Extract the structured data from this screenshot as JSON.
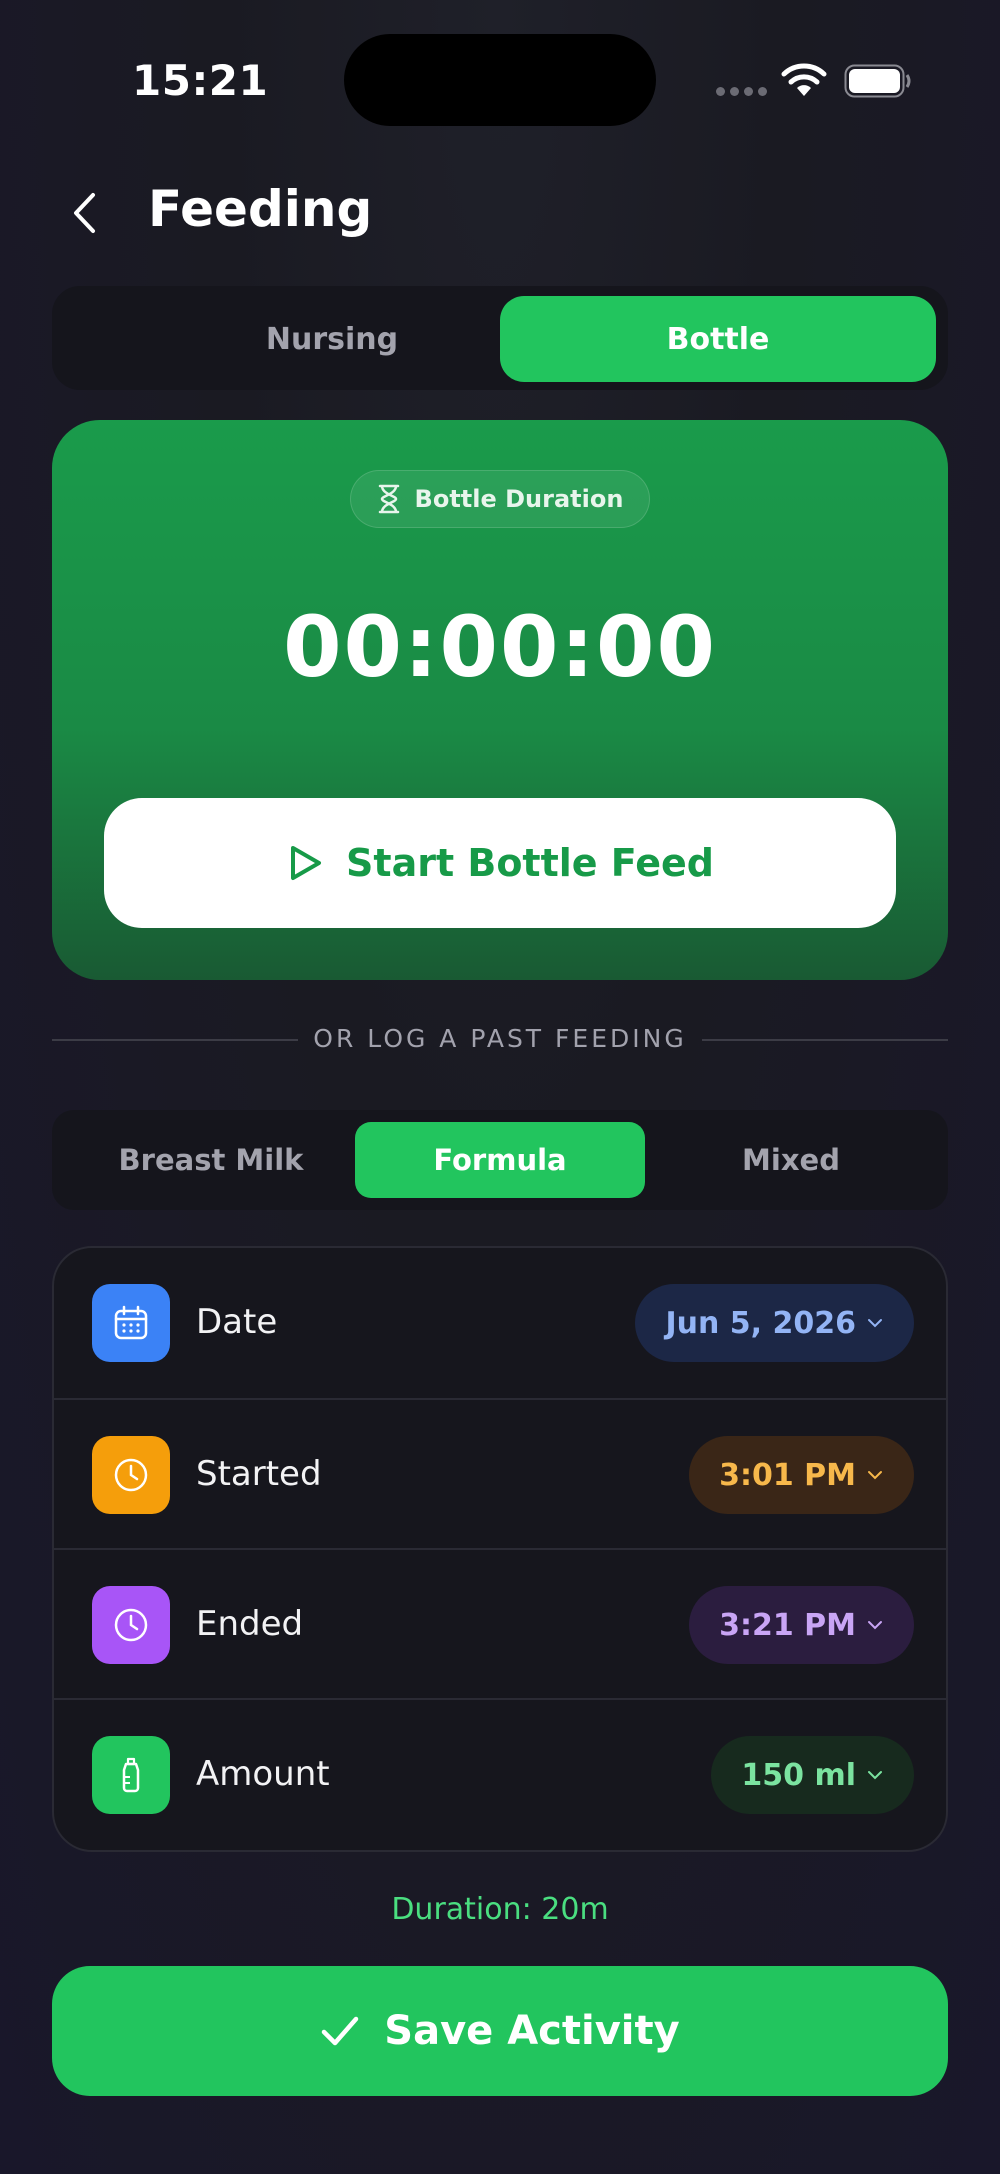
{
  "status_bar": {
    "time": "15:21"
  },
  "header": {
    "title": "Feeding"
  },
  "feed_type_tabs": [
    {
      "label": "Nursing",
      "selected": false
    },
    {
      "label": "Bottle",
      "selected": true
    }
  ],
  "timer": {
    "badge": "Bottle Duration",
    "value": "00:00:00",
    "start_label": "Start Bottle Feed"
  },
  "divider_label": "OR LOG A PAST FEEDING",
  "milk_type_tabs": [
    {
      "label": "Breast Milk",
      "selected": false
    },
    {
      "label": "Formula",
      "selected": true
    },
    {
      "label": "Mixed",
      "selected": false
    }
  ],
  "details": [
    {
      "label": "Date",
      "value": "Jun 5, 2026",
      "icon": "calendar-icon",
      "icon_color": "#3b82f6",
      "value_bg": "#1c2746",
      "value_color": "#93b4f5"
    },
    {
      "label": "Started",
      "value": "3:01 PM",
      "icon": "clock-icon",
      "icon_color": "#f59e0b",
      "value_bg": "#3a2617",
      "value_color": "#f7b84b"
    },
    {
      "label": "Ended",
      "value": "3:21 PM",
      "icon": "clock-icon",
      "icon_color": "#a855f7",
      "value_bg": "#2b1d3f",
      "value_color": "#c9a5f5"
    },
    {
      "label": "Amount",
      "value": "150 ml",
      "icon": "bottle-icon",
      "icon_color": "#22c55e",
      "value_bg": "#172a1e",
      "value_color": "#7be3a0"
    }
  ],
  "duration_text": "Duration: 20m",
  "save_label": "Save Activity",
  "colors": {
    "accent": "#22c55e",
    "background": "#1c1c24"
  }
}
